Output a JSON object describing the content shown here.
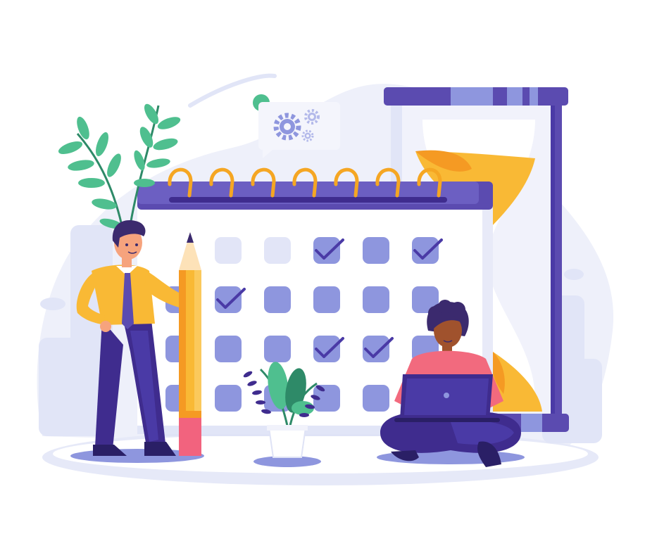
{
  "illustration": {
    "subject": "scheduling-calendar-scene",
    "colors": {
      "background": "#ffffff",
      "backdrop": "#e9ecf8",
      "backdrop_dark": "#dfe3f6",
      "calendar_header": "#5b4bb0",
      "calendar_header_light": "#6c5fc2",
      "calendar_body": "#ffffff",
      "calendar_side": "#dfe3f6",
      "cell_blue": "#8e96de",
      "cell_pale": "#e2e5f7",
      "check": "#4a3aa6",
      "ring": "#f5a623",
      "hourglass_frame": "#5b4bb0",
      "hourglass_band": "#8e96de",
      "sand": "#f9b935",
      "sand_dark": "#f59a23",
      "pencil_body": "#f9b935",
      "pencil_stripe": "#f59a23",
      "pencil_eraser": "#f2637e",
      "leaf_green": "#4fbf8f",
      "leaf_dark": "#2e8a68",
      "purple_pants": "#3f2c8e",
      "shirt_yellow": "#f9b935",
      "shirt_pink": "#f26a7e",
      "skin": "#f6a37d",
      "skin_dark": "#a0522d",
      "hair": "#3b2a6e",
      "gear": "#8e96de",
      "dot_green": "#4fbf8f"
    },
    "calendar": {
      "rows": [
        [
          "pale",
          "pale",
          "checked",
          "blue",
          "checked"
        ],
        [
          "checked",
          "blue",
          "blue",
          "blue",
          "blue"
        ],
        [
          "blue",
          "blue",
          "checked",
          "checked",
          "blue"
        ],
        [
          "blue",
          "blue",
          "blue",
          "blue",
          "none"
        ]
      ],
      "ring_count": 7
    },
    "icons": [
      "gear-icon",
      "small-gear-icon",
      "check-icon",
      "hourglass-icon",
      "pencil-icon",
      "laptop-icon",
      "plant-icon"
    ]
  }
}
